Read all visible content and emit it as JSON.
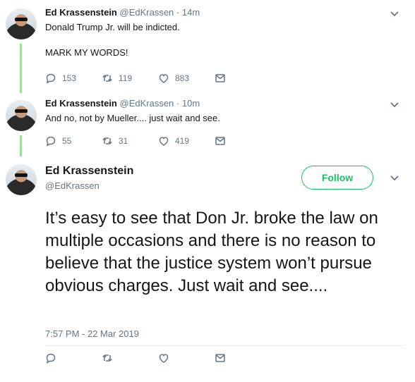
{
  "tweets": [
    {
      "name": "Ed Krassenstein",
      "handle": "@EdKrassen",
      "time": "· 14m",
      "lines": [
        "Donald Trump Jr. will be indicted.",
        "MARK MY WORDS!"
      ],
      "replies": "153",
      "retweets": "119",
      "likes": "883"
    },
    {
      "name": "Ed Krassenstein",
      "handle": "@EdKrassen",
      "time": "· 10m",
      "lines": [
        "And no, not by Mueller....  just wait and see."
      ],
      "replies": "55",
      "retweets": "31",
      "likes": "419"
    }
  ],
  "main": {
    "name": "Ed Krassenstein",
    "handle": "@EdKrassen",
    "follow_label": "Follow",
    "text": "It’s easy to see that Don Jr. broke the law on multiple occasions and there is no reason to believe that the justice system won’t pursue obvious  charges.  Just wait and see....",
    "timestamp": "7:57 PM - 22 Mar 2019"
  },
  "colors": {
    "accent": "#17bf63",
    "thread": "#9ee09a",
    "muted": "#657786"
  },
  "icons": [
    "reply-icon",
    "retweet-icon",
    "like-icon",
    "message-icon",
    "chevron-down-icon"
  ]
}
